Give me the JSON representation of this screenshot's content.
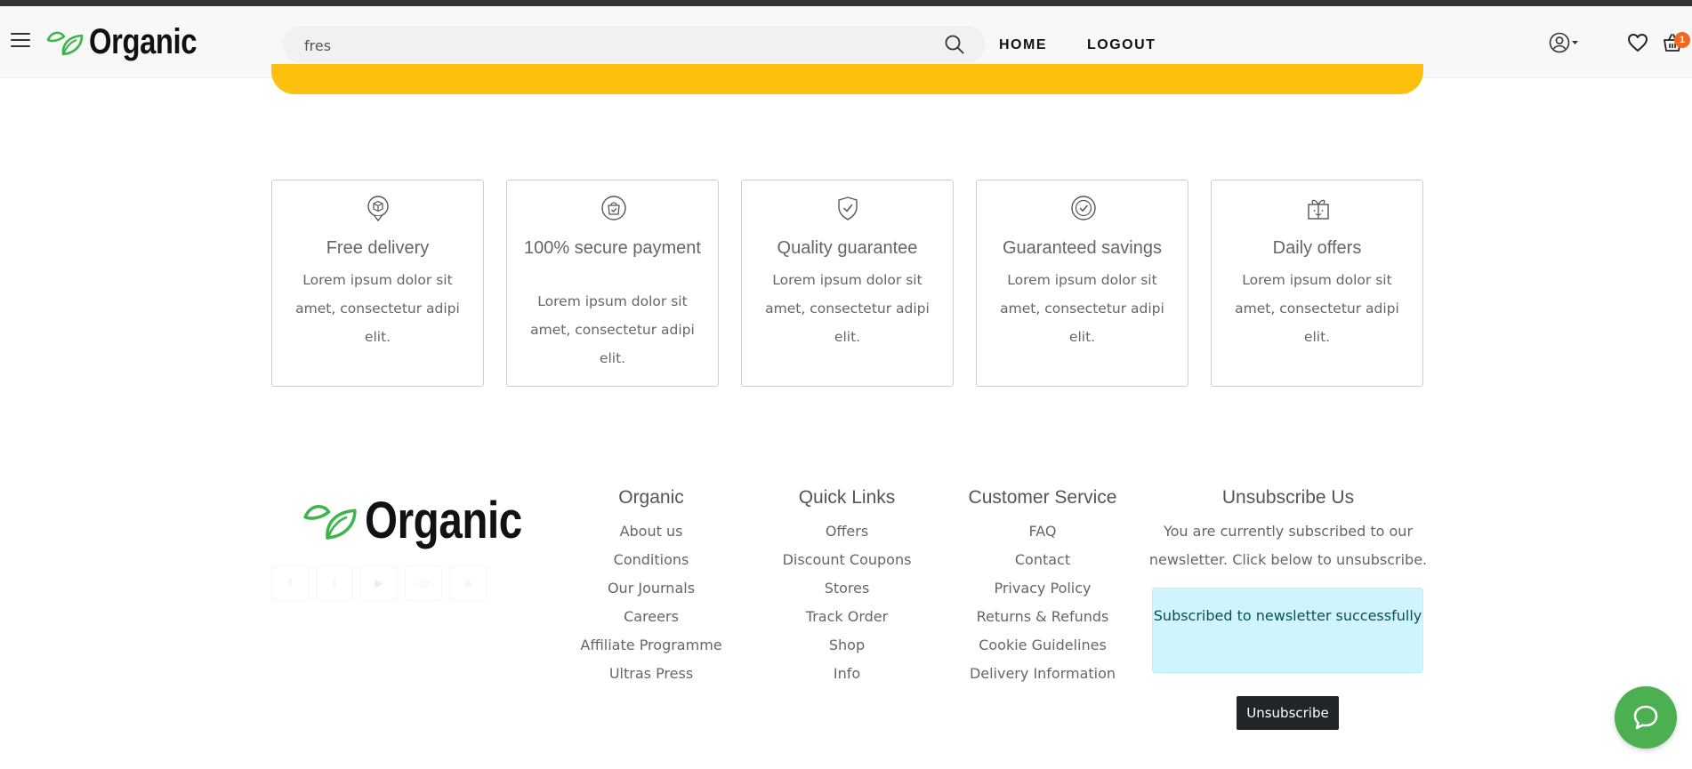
{
  "brand": {
    "name": "Organic",
    "accent": "#4caf50",
    "leaf_color": "#3cb54a",
    "banner_color": "#fdc00f"
  },
  "header": {
    "menu_icon": "hamburger-icon",
    "search": {
      "value": "fres",
      "placeholder": ""
    },
    "nav": {
      "home": "HOME",
      "logout": "LOGOUT"
    },
    "icons": [
      "user-icon",
      "heart-icon",
      "cart-icon"
    ],
    "cart_count": "1",
    "badge_color": "#f26722"
  },
  "features": [
    {
      "icon": "delivery-box-icon",
      "title": "Free delivery",
      "text": "Lorem ipsum dolor sit amet, consectetur adipi elit."
    },
    {
      "icon": "secure-bag-icon",
      "title": "100% secure payment",
      "text": "Lorem ipsum dolor sit amet, consectetur adipi elit."
    },
    {
      "icon": "shield-check-icon",
      "title": "Quality guarantee",
      "text": "Lorem ipsum dolor sit amet, consectetur adipi elit."
    },
    {
      "icon": "check-badge-icon",
      "title": "Guaranteed savings",
      "text": "Lorem ipsum dolor sit amet, consectetur adipi elit."
    },
    {
      "icon": "gift-icon",
      "title": "Daily offers",
      "text": "Lorem ipsum dolor sit amet, consectetur adipi elit."
    }
  ],
  "footer": {
    "socials": [
      "facebook-icon",
      "twitter-icon",
      "youtube-icon",
      "instagram-icon",
      "amazon-icon"
    ],
    "columns": [
      {
        "title": "Organic",
        "links": [
          "About us",
          "Conditions",
          "Our Journals",
          "Careers",
          "Affiliate Programme",
          "Ultras Press"
        ]
      },
      {
        "title": "Quick Links",
        "links": [
          "Offers",
          "Discount Coupons",
          "Stores",
          "Track Order",
          "Shop",
          "Info"
        ]
      },
      {
        "title": "Customer Service",
        "links": [
          "FAQ",
          "Contact",
          "Privacy Policy",
          "Returns & Refunds",
          "Cookie Guidelines",
          "Delivery Information"
        ]
      }
    ],
    "unsubscribe": {
      "title": "Unsubscribe Us",
      "text": "You are currently subscribed to our newsletter. Click below to unsubscribe.",
      "alert": "Subscribed to newsletter successfully",
      "button": "Unsubscribe"
    }
  },
  "chat": {
    "icon": "chat-bubble-icon"
  }
}
